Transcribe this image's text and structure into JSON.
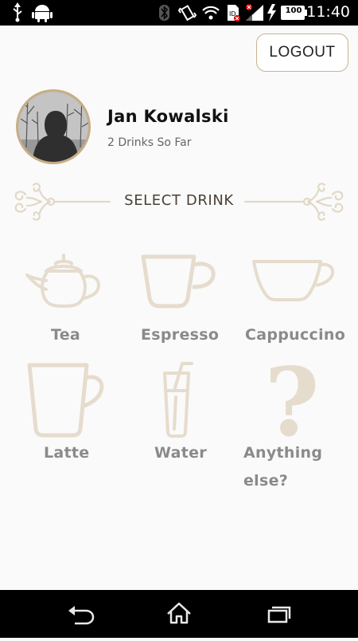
{
  "status_bar": {
    "time": "11:40",
    "battery_level": "100",
    "icons": [
      "usb-icon",
      "android-icon",
      "bluetooth-icon",
      "vibrate-icon",
      "wifi-icon",
      "sim-icon",
      "signal-icon",
      "charging-icon",
      "battery-icon"
    ]
  },
  "header": {
    "logout_label": "LOGOUT"
  },
  "profile": {
    "name": "Jan Kowalski",
    "drinks_count": "2 Drinks So Far"
  },
  "section": {
    "title": "SELECT DRINK"
  },
  "drinks": [
    {
      "label": "Tea",
      "icon": "teapot-icon"
    },
    {
      "label": "Espresso",
      "icon": "espresso-cup-icon"
    },
    {
      "label": "Cappuccino",
      "icon": "cappuccino-cup-icon"
    },
    {
      "label": "Latte",
      "icon": "latte-mug-icon"
    },
    {
      "label": "Water",
      "icon": "water-glass-icon"
    },
    {
      "label": "Anything else?",
      "line1": "Anything",
      "line2": "else?",
      "icon": "question-mark-icon"
    }
  ],
  "nav_bar": {
    "icons": [
      "back-icon",
      "home-icon",
      "recent-apps-icon"
    ]
  },
  "colors": {
    "accent": "#c8ae85",
    "icon_fill": "#e6dccd",
    "label": "#8a8a8a"
  }
}
